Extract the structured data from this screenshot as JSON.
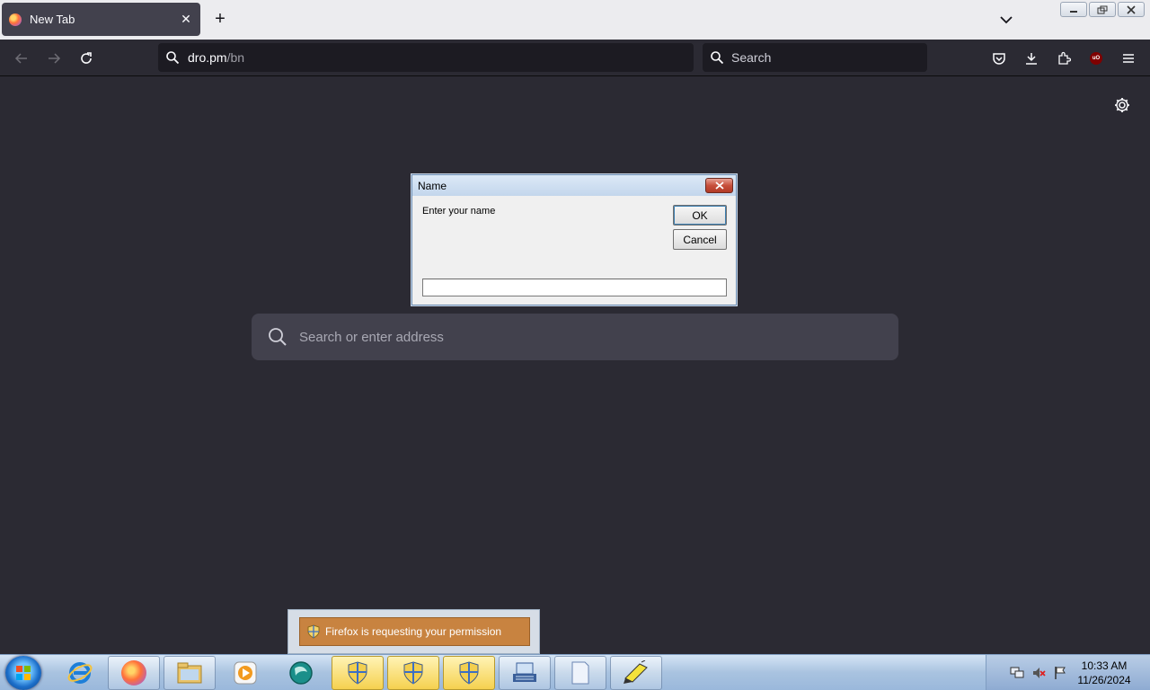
{
  "browser": {
    "tab": {
      "title": "New Tab",
      "close_glyph": "✕"
    },
    "new_tab_glyph": "+",
    "urlbar": {
      "host": "dro.pm",
      "path": "/bn"
    },
    "searchbar": {
      "placeholder": "Search"
    },
    "ublock_badge": "uO",
    "icons": [
      "firefox-icon",
      "back-arrow-icon",
      "forward-arrow-icon",
      "reload-icon",
      "search-icon",
      "pocket-icon",
      "download-icon",
      "extensions-icon",
      "ublock-icon",
      "menu-icon",
      "gear-icon",
      "chevron-down-icon"
    ]
  },
  "content": {
    "search_placeholder": "Search or enter address"
  },
  "dialog": {
    "title": "Name",
    "message": "Enter your name",
    "ok_label": "OK",
    "cancel_label": "Cancel",
    "input_value": ""
  },
  "notification": {
    "text": "Firefox is requesting your permission"
  },
  "taskbar": {
    "clock_time": "10:33 AM",
    "clock_date": "11/26/2024",
    "items": [
      "internet-explorer",
      "firefox",
      "file-explorer",
      "media-player",
      "app-globe",
      "uac-prompt",
      "uac-prompt",
      "uac-prompt",
      "keyboard-app",
      "blank-document",
      "pencil-app"
    ]
  },
  "colors": {
    "chrome_dark": "#2b2a33",
    "field_dark": "#1c1b22",
    "tab_active": "#42414d",
    "notification": "#c88340"
  }
}
